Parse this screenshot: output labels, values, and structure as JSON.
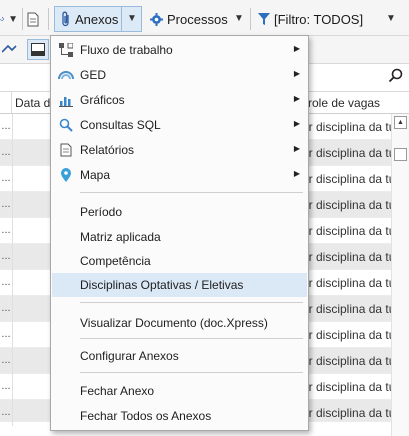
{
  "toolbar": {
    "anexos_label": "Anexos",
    "processos_label": "Processos",
    "filter_label": "[Filtro: TODOS]"
  },
  "grid": {
    "col_date_header": "Data de",
    "col_control_header": "ntrole de vagas",
    "row_marker": "...",
    "row_text": "or disciplina da tur"
  },
  "menu": {
    "submenu_items": [
      {
        "label": "Fluxo de trabalho",
        "icon": "workflow-icon"
      },
      {
        "label": "GED",
        "icon": "ged-icon"
      },
      {
        "label": "Gráficos",
        "icon": "chart-icon"
      },
      {
        "label": "Consultas SQL",
        "icon": "search-icon"
      },
      {
        "label": "Relatórios",
        "icon": "report-icon"
      },
      {
        "label": "Mapa",
        "icon": "map-pin-icon"
      }
    ],
    "group2": [
      "Período",
      "Matriz aplicada",
      "Competência",
      "Disciplinas Optativas / Eletivas"
    ],
    "view_doc": "Visualizar Documento (doc.Xpress)",
    "configure": "Configurar Anexos",
    "close_one": "Fechar Anexo",
    "close_all": "Fechar Todos os Anexos",
    "highlighted_item": "Disciplinas Optativas / Eletivas"
  },
  "colors": {
    "highlight": "#dbe8f6",
    "accent": "#1a73c8"
  }
}
